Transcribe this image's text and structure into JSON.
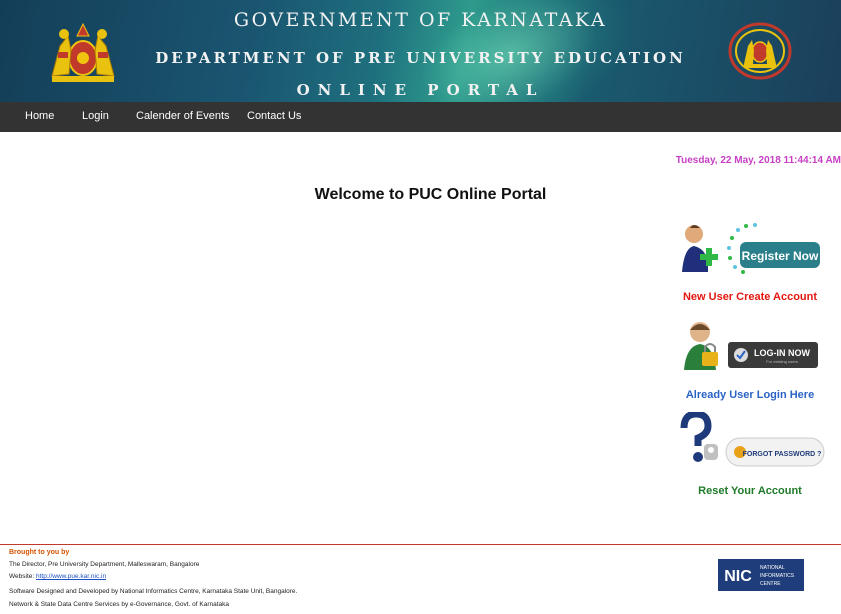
{
  "banner": {
    "title_line1": "GOVERNMENT OF KARNATAKA",
    "title_line2": "DEPARTMENT OF PRE UNIVERSITY EDUCATION",
    "title_line3": "ONLINE PORTAL"
  },
  "nav": {
    "items": [
      {
        "label": "Home"
      },
      {
        "label": "Login"
      },
      {
        "label": "Calender of Events"
      },
      {
        "label": "Contact Us"
      }
    ]
  },
  "main": {
    "datetime": "Tuesday, 22 May, 2018 11:44:14 AM",
    "welcome": "Welcome to PUC Online Portal"
  },
  "actions": {
    "register": {
      "button_text": "Register Now",
      "caption": "New User Create Account",
      "caption_color": "#e3170f"
    },
    "login": {
      "button_text": "LOG-IN NOW",
      "button_subtext": "For existing users",
      "caption": "Already User Login Here",
      "caption_color": "#2a63c4"
    },
    "forgot": {
      "button_text": "FORGOT PASSWORD ?",
      "caption": "Reset Your Account",
      "caption_color": "#1f7a2a"
    }
  },
  "footer": {
    "heading": "Brought to you by",
    "line1": "The Director, Pre University Department, Malleswaram, Bangalore",
    "website_label": "Website: ",
    "website_url": "http://www.pue.kar.nic.in",
    "line3": "Software Designed and Developed by National Informatics Centre, Karnataka State Unit, Bangalore.",
    "line4": "Network & State Data Centre Services by e-Governance, Govt. of Karnataka",
    "nic_logo": {
      "abbr": "NIC",
      "text_line1": "NATIONAL",
      "text_line2": "INFORMATICS",
      "text_line3": "CENTRE"
    }
  },
  "icons": {
    "left_emblem": "karnataka-emblem-icon",
    "right_emblem": "karnataka-seal-icon",
    "register": "user-plus-icon",
    "login": "user-lock-icon",
    "forgot": "question-key-icon"
  },
  "colors": {
    "nav_bg": "#333333",
    "datetime": "#c83fc4",
    "footer_border": "#c0392b"
  }
}
